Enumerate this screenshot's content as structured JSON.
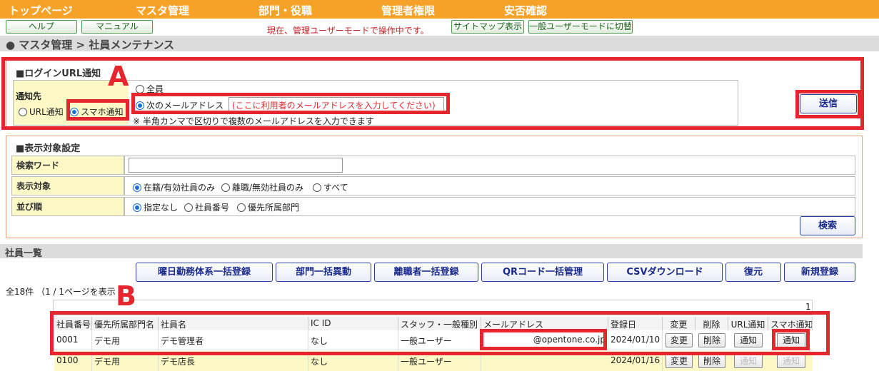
{
  "topnav": [
    "トップページ",
    "マスタ管理",
    "部門・役職",
    "管理者権限",
    "安否確認"
  ],
  "sub_buttons": {
    "help": "ヘルプ",
    "manual": "マニュアル",
    "sitemap": "サイトマップ表示",
    "switch_mode": "一般ユーザーモードに切替"
  },
  "mode_message": "現在、管理ユーザーモードで操作中です。",
  "breadcrumb": "● マスタ管理 > 社員メンテナンス",
  "annotations": {
    "a": "A",
    "b": "B"
  },
  "login_notice": {
    "title": "■ログインURL通知",
    "dest_label": "通知先",
    "dest_url": "URL通知",
    "dest_smart": "スマホ通知",
    "opt_all": "全員",
    "opt_email": "次のメールアドレス",
    "email_placeholder": "(ここに利用者のメールアドレスを入力してください)",
    "hint": "※ 半角カンマで区切りで複数のメールアドレスを入力できます",
    "send": "送信"
  },
  "display_settings": {
    "title": "■表示対象設定",
    "search_word": "検索ワード",
    "target": "表示対象",
    "target_opts": [
      "在籍/有効社員のみ",
      "離職/無効社員のみ",
      "すべて"
    ],
    "order": "並び順",
    "order_opts": [
      "指定なし",
      "社員番号",
      "優先所属部門"
    ],
    "search": "検索"
  },
  "list_title": "社員一覧",
  "actions": [
    "曜日勤務体系一括登録",
    "部門一括異動",
    "離職者一括登録",
    "QRコード一括管理",
    "CSVダウンロード",
    "復元",
    "新規登録"
  ],
  "count_text": "全18件 （1 / 1ページを表示",
  "page_num": "1",
  "columns": [
    "社員番号",
    "優先所属部門名",
    "社員名",
    "IC ID",
    "スタッフ・一般種別",
    "メールアドレス",
    "登録日",
    "変更",
    "削除",
    "URL通知",
    "スマホ通知"
  ],
  "rows": [
    {
      "no": "0001",
      "dept": "デモ用",
      "name": "デモ管理者",
      "icid": "なし",
      "type": "一般ユーザー",
      "email": "@opentone.co.jp",
      "date": "2024/01/10",
      "edit": "変更",
      "del": "削除",
      "url": "通知",
      "smart": "通知"
    },
    {
      "no": "0100",
      "dept": "デモ用",
      "name": "デモ店長",
      "icid": "なし",
      "type": "一般ユーザー",
      "email": "",
      "date": "2024/01/16",
      "edit": "変更",
      "del": "削除",
      "url": "通知",
      "smart": "通知"
    }
  ]
}
